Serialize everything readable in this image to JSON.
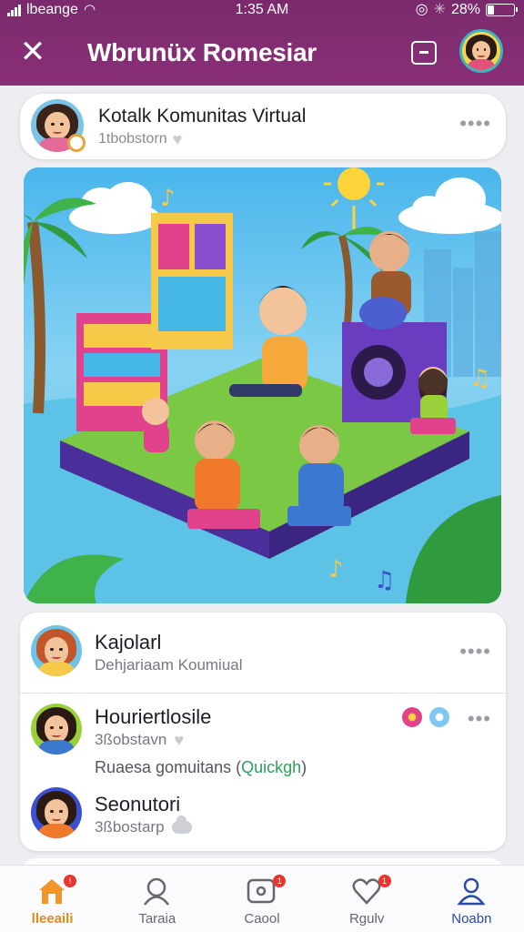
{
  "status_bar": {
    "carrier": "lbeange",
    "time": "1:35 AM",
    "battery": "28%",
    "battery_level": 0.28
  },
  "app_bar": {
    "title": "Wbrunüx Romesiar",
    "icons": [
      "close-icon",
      "share-icon",
      "profile-avatar"
    ]
  },
  "group": {
    "name": "Kotalk Komunitas Virtual",
    "subtitle": "1tbobstorn"
  },
  "hero": {
    "description_icon": "community-illustration"
  },
  "list": [
    {
      "title": "Kajolarl",
      "subtitle": "Dehjariaam Koumiual"
    },
    {
      "title": "Houriertlosile",
      "subtitle": "3ßobstavn",
      "extra_prefix": "Ruaesa gomuitans (",
      "extra_accent": "Quickgh",
      "extra_suffix": ")"
    },
    {
      "title": "Seonutori",
      "subtitle": "3ßbostarp"
    }
  ],
  "bottom_nav": [
    {
      "label": "lleeaili",
      "icon": "home-icon",
      "active": true,
      "badge": true
    },
    {
      "label": "Taraia",
      "icon": "people-icon",
      "active": false,
      "badge": false
    },
    {
      "label": "Caool",
      "icon": "chat-icon",
      "active": false,
      "badge": true
    },
    {
      "label": "Rgulv",
      "icon": "heart-icon",
      "active": false,
      "badge": true
    },
    {
      "label": "Noabn",
      "icon": "profile-icon",
      "active": false,
      "badge": false
    }
  ],
  "colors": {
    "brand": "#8a2f78",
    "active_nav": "#e08a1e",
    "accent_green": "#2da05a",
    "badge": "#e8362e"
  }
}
